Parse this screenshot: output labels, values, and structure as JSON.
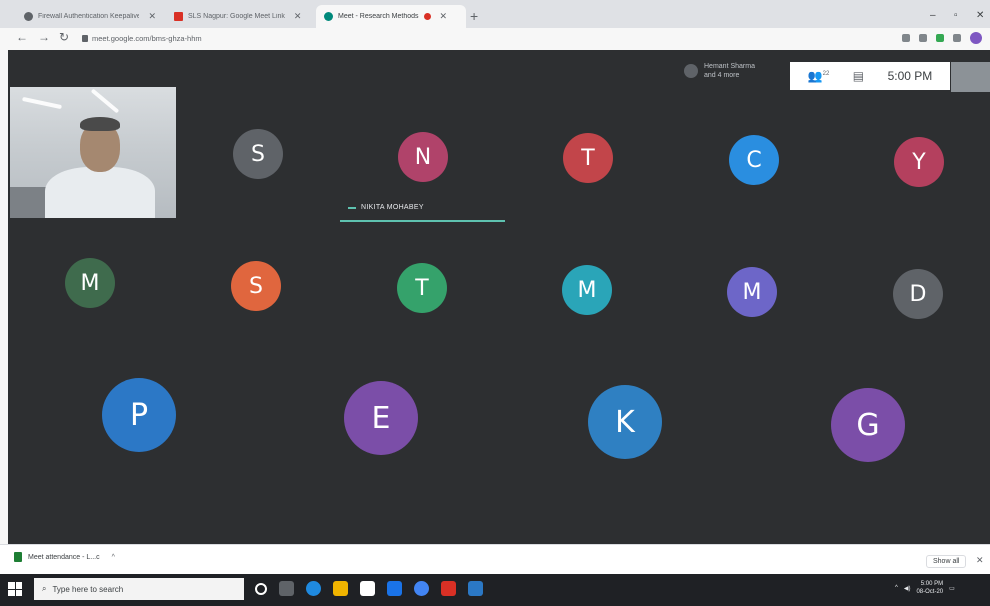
{
  "browser": {
    "tabs": [
      {
        "title": "Firewall Authentication Keepalive",
        "active": false,
        "favicon_color": "#5f6368"
      },
      {
        "title": "SLS Nagpur: Google Meet Link",
        "active": false,
        "favicon_color": "#d93025"
      },
      {
        "title": "Meet - Research Methods",
        "active": true,
        "favicon_color": "#00897b"
      }
    ],
    "new_tab_symbol": "+",
    "window_controls": [
      "–",
      "▫",
      "✕"
    ],
    "url": "meet.google.com/bms-ghza-hhm"
  },
  "meet": {
    "presenter_line1": "Hemant Sharma",
    "presenter_line2": "and 4 more",
    "participants_count": "22",
    "time": "5:00 PM",
    "active_speaker": "NIKITA MOHABEY",
    "participants": [
      {
        "initial": "S",
        "color": "#5f6368"
      },
      {
        "initial": "N",
        "color": "#b0436a"
      },
      {
        "initial": "T",
        "color": "#c2454a"
      },
      {
        "initial": "C",
        "color": "#2a8ee0"
      },
      {
        "initial": "Y",
        "color": "#b4405e"
      },
      {
        "initial": "M",
        "color": "#3f6b4d"
      },
      {
        "initial": "S",
        "color": "#e0663e"
      },
      {
        "initial": "T",
        "color": "#35a26b"
      },
      {
        "initial": "M",
        "color": "#2aa5b8"
      },
      {
        "initial": "M",
        "color": "#6d66c8"
      },
      {
        "initial": "D",
        "color": "#5f6368"
      },
      {
        "initial": "P",
        "color": "#2c78c6"
      },
      {
        "initial": "E",
        "color": "#7b4ea8"
      },
      {
        "initial": "K",
        "color": "#2f80c2"
      },
      {
        "initial": "G",
        "color": "#7b4ea8"
      }
    ]
  },
  "downloads": {
    "file_name": "Meet attendance - L...c",
    "show_all_label": "Show all",
    "close_symbol": "✕"
  },
  "taskbar": {
    "search_placeholder": "Type here to search",
    "time": "5:00 PM",
    "date": "08-Oct-20"
  }
}
